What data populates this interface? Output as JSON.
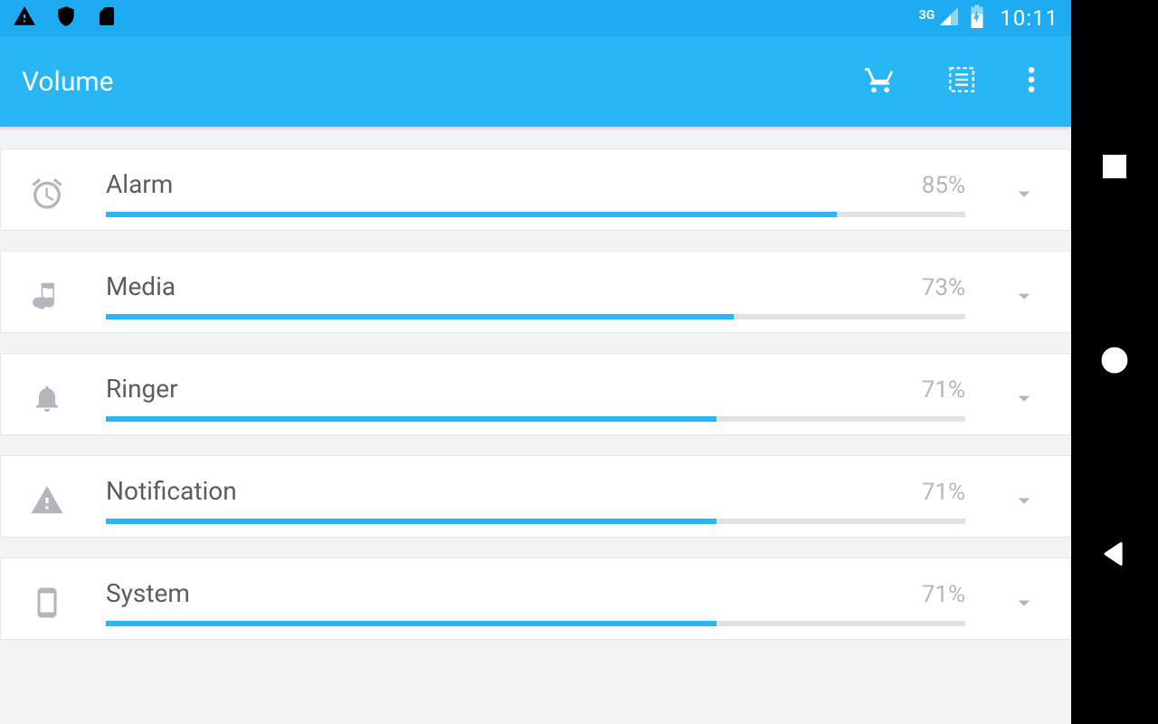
{
  "status": {
    "network": "3G",
    "time": "10:11"
  },
  "app": {
    "title": "Volume"
  },
  "channels": [
    {
      "id": "alarm",
      "label": "Alarm",
      "percent": 85,
      "percent_label": "85%",
      "icon": "alarm"
    },
    {
      "id": "media",
      "label": "Media",
      "percent": 73,
      "percent_label": "73%",
      "icon": "music"
    },
    {
      "id": "ringer",
      "label": "Ringer",
      "percent": 71,
      "percent_label": "71%",
      "icon": "bell"
    },
    {
      "id": "notification",
      "label": "Notification",
      "percent": 71,
      "percent_label": "71%",
      "icon": "warning"
    },
    {
      "id": "system",
      "label": "System",
      "percent": 71,
      "percent_label": "71%",
      "icon": "phone"
    }
  ],
  "colors": {
    "accent": "#29b6f6",
    "status_bar": "#1fabf2",
    "muted": "#b3b7bd",
    "bg": "#f2f3f5"
  }
}
